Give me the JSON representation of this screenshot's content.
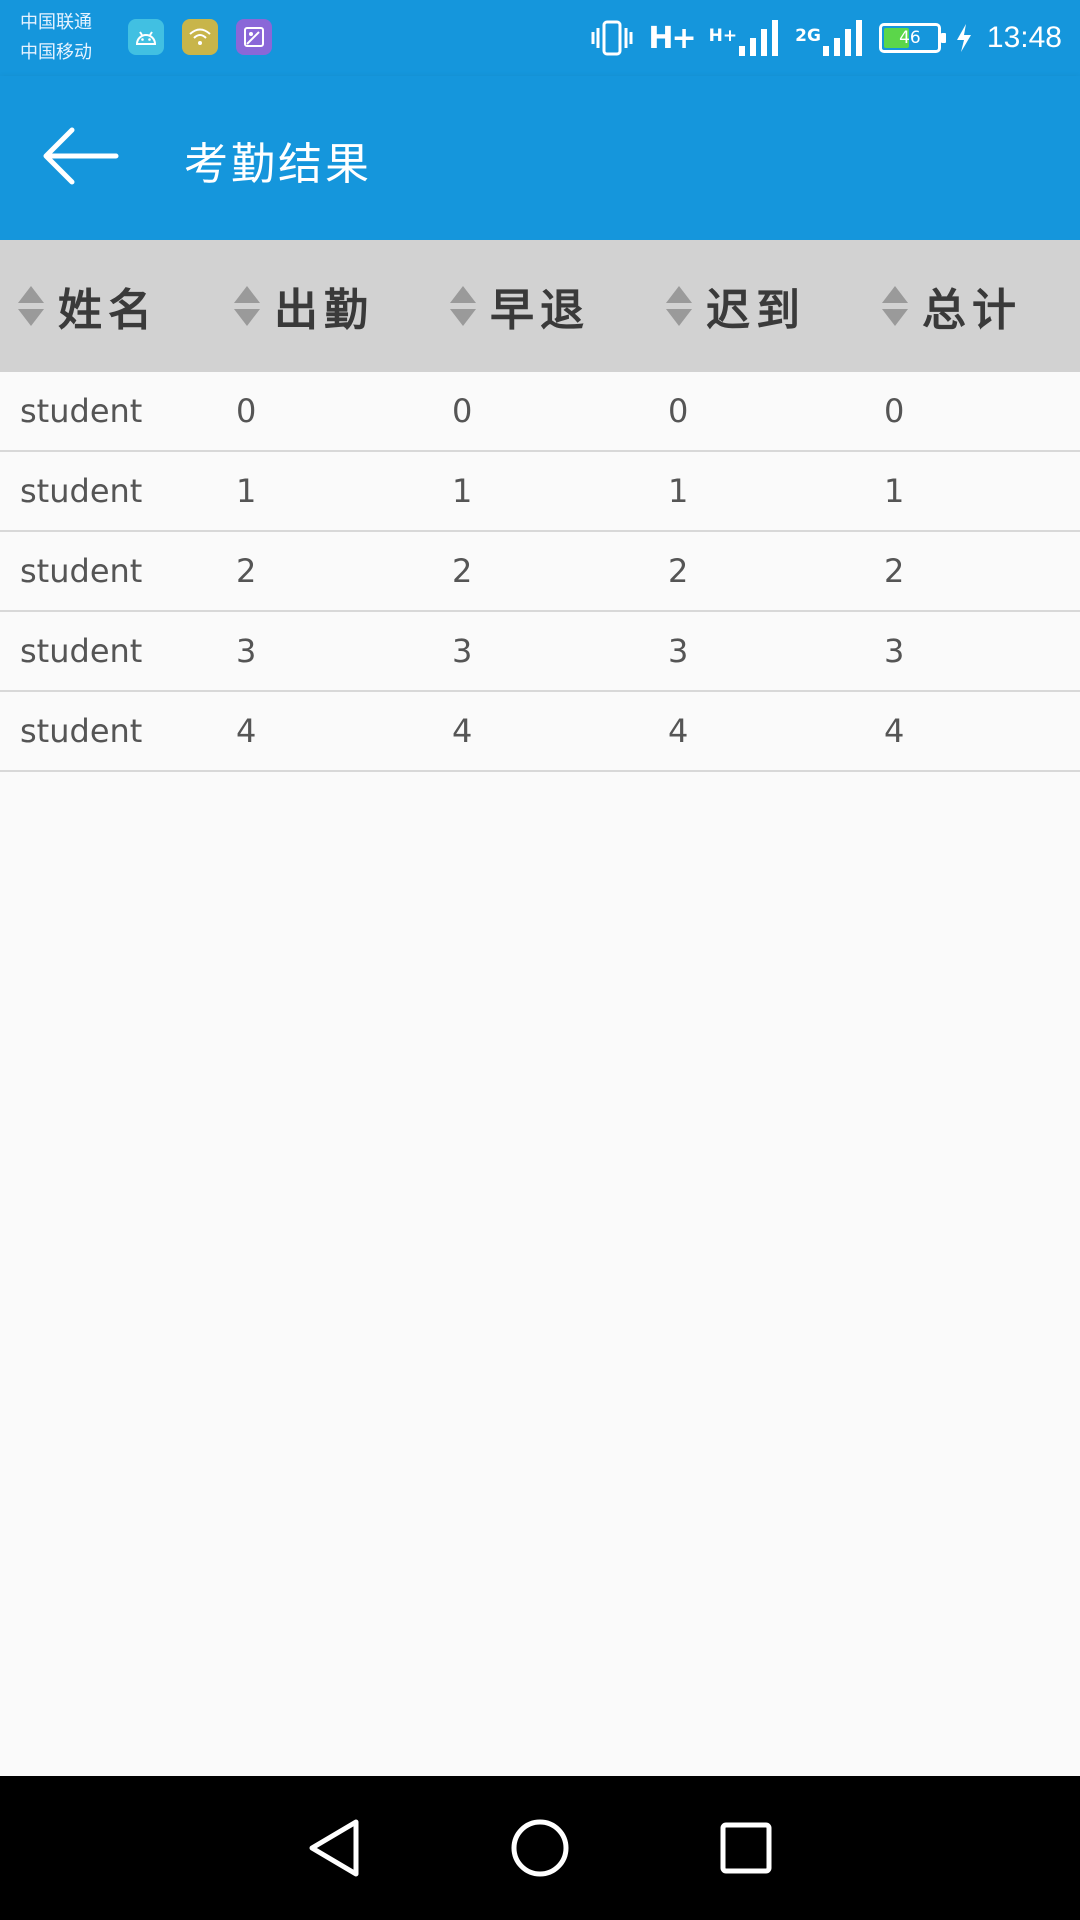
{
  "status_bar": {
    "carrier1": "中国联通",
    "carrier2": "中国移动",
    "net1": "H+",
    "net2": "H+",
    "net3": "2G",
    "battery": "46",
    "time": "13:48"
  },
  "app_bar": {
    "title": "考勤结果"
  },
  "table": {
    "headers": [
      "姓名",
      "出勤",
      "早退",
      "迟到",
      "总计"
    ],
    "rows": [
      [
        "student",
        "0",
        "0",
        "0",
        "0"
      ],
      [
        "student",
        "1",
        "1",
        "1",
        "1"
      ],
      [
        "student",
        "2",
        "2",
        "2",
        "2"
      ],
      [
        "student",
        "3",
        "3",
        "3",
        "3"
      ],
      [
        "student",
        "4",
        "4",
        "4",
        "4"
      ]
    ]
  },
  "colors": {
    "primary": "#1596dc",
    "header_bg": "#d2d2d2",
    "background": "#fafafa",
    "navbar": "#000000"
  }
}
